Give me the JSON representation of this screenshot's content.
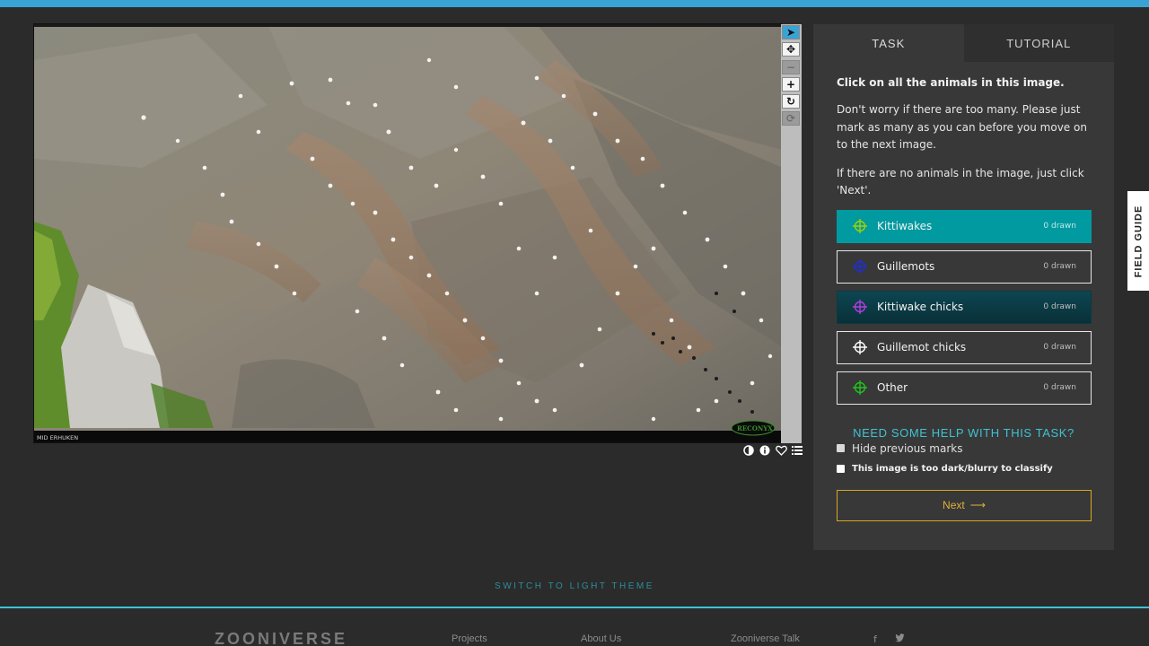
{
  "subject": {
    "caption": "MID ERHUKEN",
    "watermark": "RECONYX"
  },
  "toolbar": {
    "tools": [
      {
        "name": "pointer",
        "glyph": "➤"
      },
      {
        "name": "move",
        "glyph": "✥"
      },
      {
        "name": "zoom-out",
        "glyph": "−"
      },
      {
        "name": "zoom-in",
        "glyph": "+"
      },
      {
        "name": "rotate",
        "glyph": "↻"
      },
      {
        "name": "reset",
        "glyph": "⟳"
      }
    ]
  },
  "subject_actions": {
    "icons": [
      "contrast-icon",
      "info-icon",
      "favorite-icon",
      "collections-icon"
    ],
    "glyphs": [
      "◐",
      "ℹ",
      "♡",
      "☰"
    ]
  },
  "task": {
    "tabs": [
      "Task",
      "Tutorial"
    ],
    "question": "Click on all the animals in this image.",
    "help_1": "Don't worry if there are too many. Please just mark as many as you can before you move on to the next image.",
    "help_2": "If there are no animals in the image, just click 'Next'.",
    "choices": [
      {
        "label": "Kittiwakes",
        "count": "0 drawn",
        "color": "#9fd300",
        "state": "selected"
      },
      {
        "label": "Guillemots",
        "count": "0 drawn",
        "color": "#1f2fd6",
        "state": "normal"
      },
      {
        "label": "Kittiwake chicks",
        "count": "0 drawn",
        "color": "#b43ce0",
        "state": "hovered"
      },
      {
        "label": "Guillemot chicks",
        "count": "0 drawn",
        "color": "#ffffff",
        "state": "normal"
      },
      {
        "label": "Other",
        "count": "0 drawn",
        "color": "#22c21e",
        "state": "normal"
      }
    ],
    "need_help": "Need some help with this task?",
    "hide_marks": "Hide previous marks",
    "too_dark": "This image is too dark/blurry to classify",
    "next_label": "Next",
    "next_arrow": "⟶"
  },
  "field_guide": "FIELD GUIDE",
  "theme_switch": "Switch to light theme",
  "footer": {
    "logo": "ZOONIVERSE",
    "links": [
      "Projects",
      "About Us",
      "Zooniverse Talk"
    ],
    "social": [
      "f",
      "🐦"
    ]
  },
  "colors": {
    "accent": "#3aa3d6",
    "selected": "#009aa0",
    "next_border": "#d7a521",
    "help_link": "#3ec3d3"
  }
}
